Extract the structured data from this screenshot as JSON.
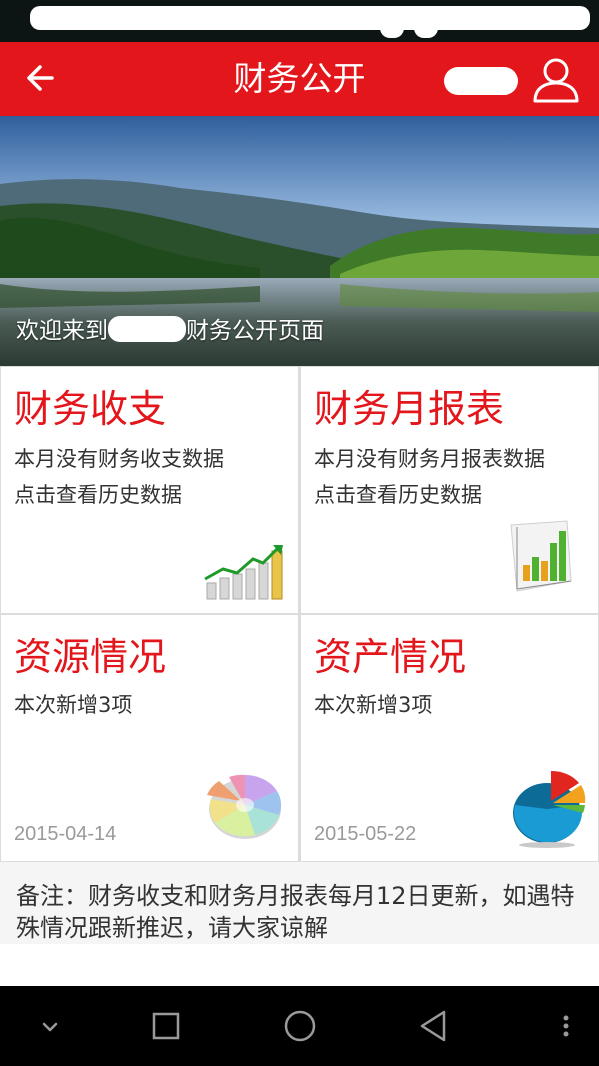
{
  "header": {
    "title": "财务公开",
    "back_icon": "arrow-left-icon",
    "user_icon": "user-icon",
    "background": "#e3161c"
  },
  "banner": {
    "welcome_prefix": "欢迎来到",
    "welcome_suffix": "财务公开页面"
  },
  "cards": [
    {
      "title": "财务收支",
      "lines": [
        "本月没有财务收支数据",
        "点击查看历史数据"
      ],
      "icon": "growth-bar-chart-icon"
    },
    {
      "title": "财务月报表",
      "lines": [
        "本月没有财务月报表数据",
        "点击查看历史数据"
      ],
      "icon": "3d-bar-chart-icon"
    },
    {
      "title": "资源情况",
      "lines": [
        "本次新增3项"
      ],
      "date": "2015-04-14",
      "icon": "pie-chart-pastel-icon"
    },
    {
      "title": "资产情况",
      "lines": [
        "本次新增3项"
      ],
      "date": "2015-05-22",
      "icon": "pie-chart-3d-icon"
    }
  ],
  "note": {
    "text": "备注：财务收支和财务月报表每月12日更新，如遇特殊情况跟新推迟，请大家谅解"
  },
  "navbar": {
    "icons": [
      "chevron-down-icon",
      "recents-square-icon",
      "home-circle-icon",
      "back-triangle-icon",
      "more-vert-icon"
    ]
  }
}
